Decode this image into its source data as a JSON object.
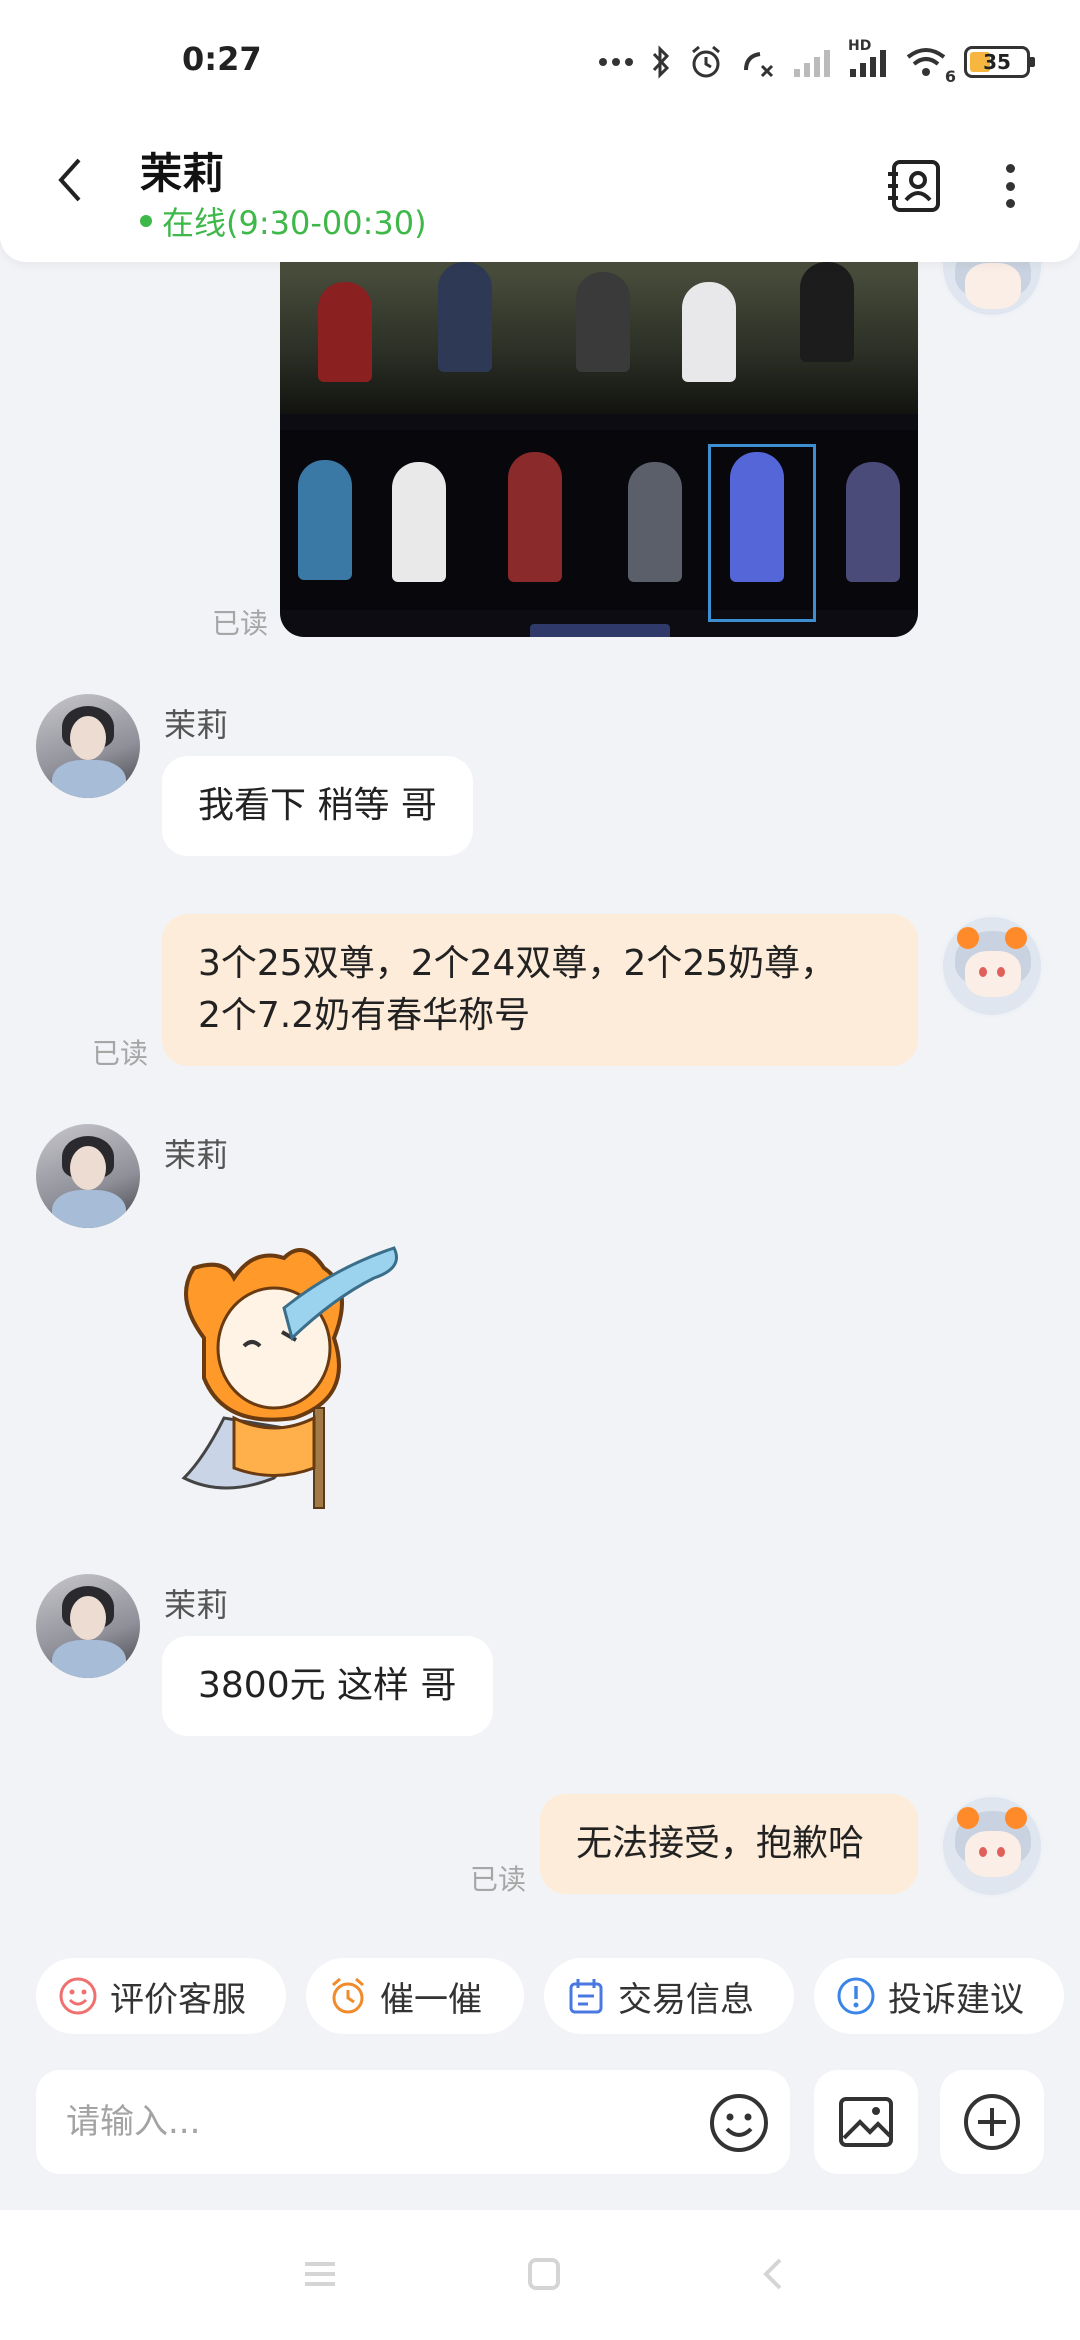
{
  "status_bar": {
    "time": "0:27",
    "battery": "35",
    "signal_label": "HD",
    "wifi_label": "6"
  },
  "header": {
    "contact_name": "茉莉",
    "online_status": "在线(9:30-00:30)",
    "online_color": "#3fb84a"
  },
  "messages": {
    "read_label": "已读",
    "sender_name": "茉莉",
    "msg1": "我看下 稍等 哥",
    "msg2": "3个25双尊，2个24双尊，2个25奶尊，\n2个7.2奶有春华称号",
    "msg4": "3800元 这样 哥",
    "msg5": "无法接受，抱歉哈"
  },
  "quick_actions": [
    {
      "label": "评价客服",
      "icon": "smile-icon",
      "color": "#f07070"
    },
    {
      "label": "催一催",
      "icon": "alarm-clock-icon",
      "color": "#f08a2a"
    },
    {
      "label": "交易信息",
      "icon": "calendar-icon",
      "color": "#4a78e0"
    },
    {
      "label": "投诉建议",
      "icon": "exclamation-icon",
      "color": "#3a86e8"
    }
  ],
  "input": {
    "placeholder": "请输入..."
  },
  "colors": {
    "accent_green": "#3fb84a",
    "my_bubble": "#fdecd9",
    "their_bubble": "#ffffff",
    "background": "#f2f3f6"
  }
}
